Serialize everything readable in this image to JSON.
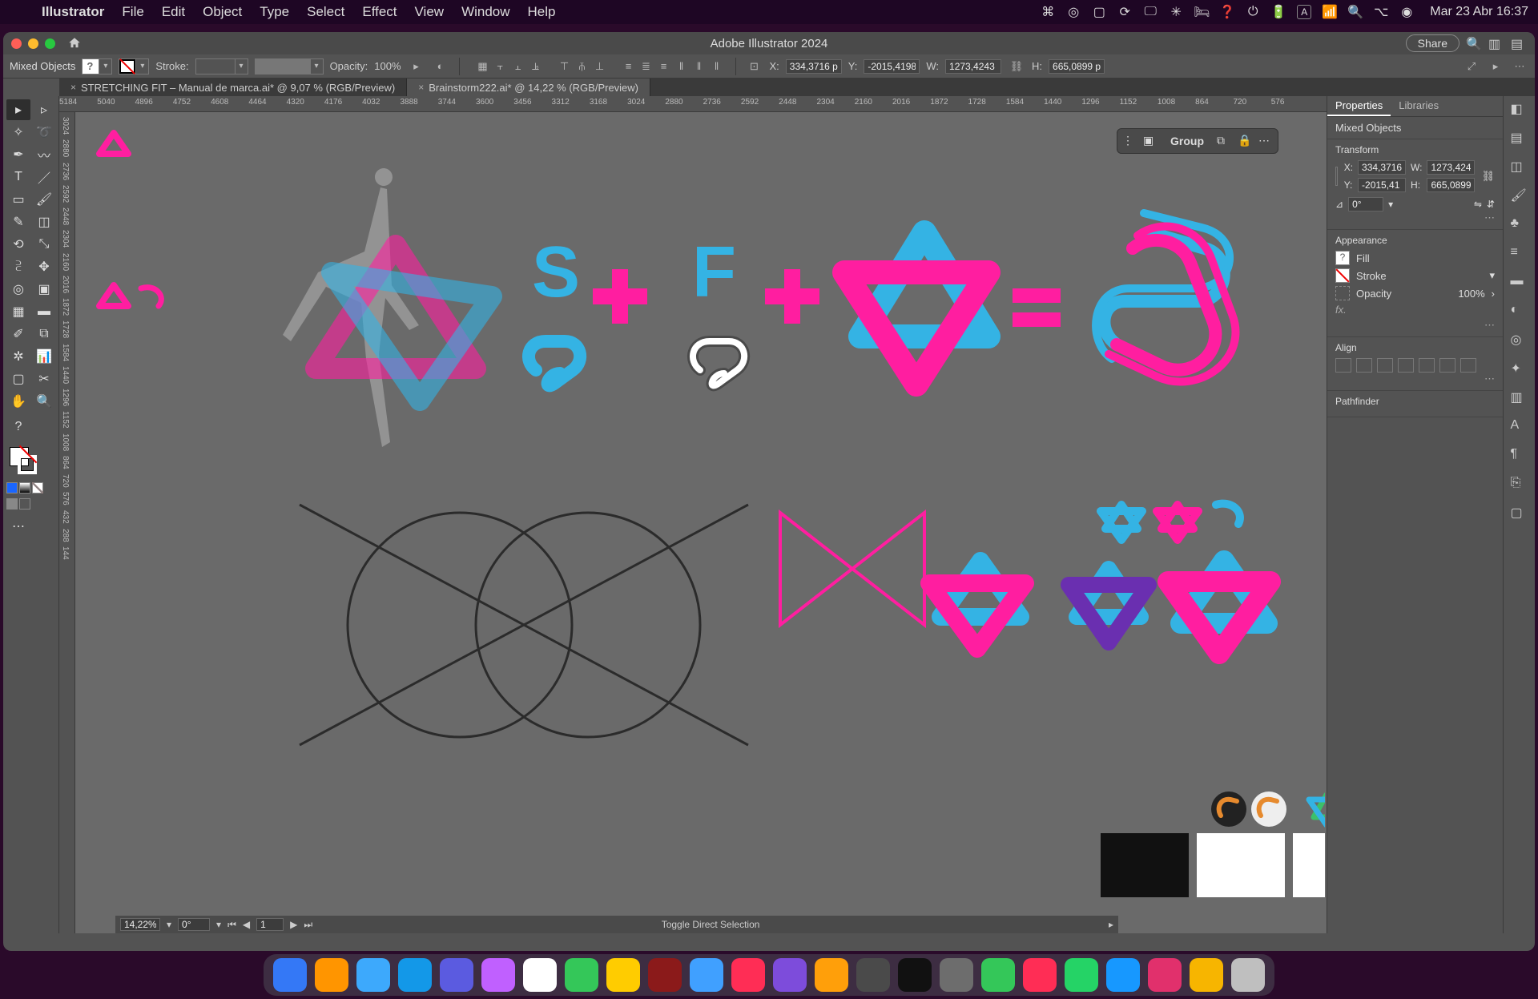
{
  "os": {
    "app_name": "Illustrator",
    "menus": [
      "File",
      "Edit",
      "Object",
      "Type",
      "Select",
      "Effect",
      "View",
      "Window",
      "Help"
    ],
    "date_time": "Mar 23 Abr 16:37"
  },
  "titlebar": {
    "window_title": "Adobe Illustrator 2024",
    "share_btn": "Share"
  },
  "controlbar": {
    "selection_label": "Mixed Objects",
    "stroke_label": "Stroke:",
    "opacity_label": "Opacity:",
    "opacity_value": "100%",
    "x_label": "X:",
    "x_value": "334,3716 pt",
    "y_label": "Y:",
    "y_value": "-2015,4198",
    "w_label": "W:",
    "w_value": "1273,4243 p",
    "h_label": "H:",
    "h_value": "665,0899 pt"
  },
  "tabs": [
    {
      "label": "STRETCHING FIT – Manual de marca.ai* @ 9,07 % (RGB/Preview)",
      "active": false
    },
    {
      "label": "Brainstorm222.ai* @ 14,22 % (RGB/Preview)",
      "active": true
    }
  ],
  "ruler_ticks": [
    "5184",
    "5040",
    "4896",
    "4752",
    "4608",
    "4464",
    "4320",
    "4176",
    "4032",
    "3888",
    "3744",
    "3600",
    "3456",
    "3312",
    "3168",
    "3024",
    "2880",
    "2736",
    "2592",
    "2448",
    "2304",
    "2160",
    "2016",
    "1872",
    "1728",
    "1584",
    "1440",
    "1296",
    "1152",
    "1008",
    "864",
    "720",
    "576"
  ],
  "vruler_ticks": [
    "3024",
    "2880",
    "2736",
    "2592",
    "2448",
    "2304",
    "2160",
    "2016",
    "1872",
    "1728",
    "1584",
    "1440",
    "1296",
    "1152",
    "1008",
    "864",
    "720",
    "576",
    "432",
    "288",
    "144"
  ],
  "float_toolbar": {
    "group_btn": "Group"
  },
  "properties": {
    "panels": [
      "Properties",
      "Libraries"
    ],
    "active_panel": "Properties",
    "selection": "Mixed Objects",
    "sections": {
      "transform": {
        "title": "Transform",
        "x": "334,3716",
        "y": "-2015,41",
        "w": "1273,424",
        "h": "665,0899",
        "rotation": "0°"
      },
      "appearance": {
        "title": "Appearance",
        "fill_label": "Fill",
        "stroke_label": "Stroke",
        "opacity_label": "Opacity",
        "opacity_value": "100%",
        "fx_label": "fx."
      },
      "align": {
        "title": "Align"
      },
      "pathfinder": {
        "title": "Pathfinder"
      }
    }
  },
  "statusbar": {
    "zoom": "14,22%",
    "rotation": "0°",
    "artboard": "1",
    "hint": "Toggle Direct Selection"
  },
  "artwork": {
    "colors": {
      "cyan": "#34b3e4",
      "magenta": "#ff1ea0",
      "purple": "#6a2fb0",
      "gray": "#9a9a9a",
      "dark": "#2b2b2b"
    },
    "letters": {
      "s": "S",
      "f": "F"
    },
    "symbols": {
      "plus": "+",
      "equals": "="
    }
  },
  "dock_apps": [
    "#3478f6",
    "#ff9500",
    "#3da9fc",
    "#1398e8",
    "#5b5be0",
    "#c060ff",
    "#ffffff",
    "#34c759",
    "#ffcc00",
    "#8b1a1a",
    "#40a0ff",
    "#ff2d55",
    "#7d4cdb",
    "#ff9f0a",
    "#4a4a4a",
    "#111111",
    "#6d6d6d",
    "#34c759",
    "#ff2d55",
    "#25d366",
    "#1798ff",
    "#e1306c",
    "#f7b500",
    "#bfbfbf"
  ]
}
